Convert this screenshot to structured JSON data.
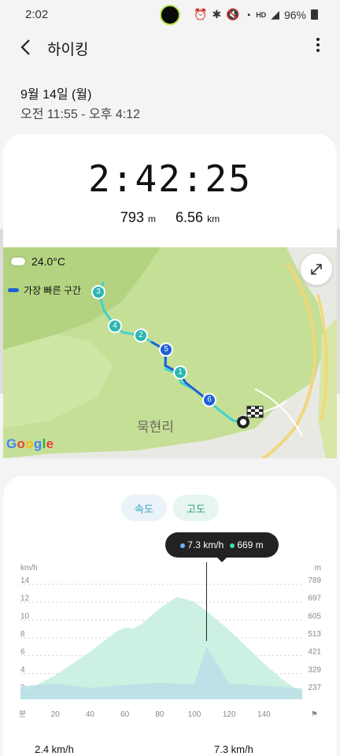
{
  "status": {
    "time": "2:02",
    "battery": "96%",
    "icons": [
      "alarm-icon",
      "bluetooth-icon",
      "mute-icon",
      "wifi-icon",
      "hd-icon",
      "signal-icon",
      "battery-icon"
    ]
  },
  "appbar": {
    "title": "하이킹"
  },
  "session": {
    "date": "9월 14일 (월)",
    "time_range": "오전 11:55 - 오후 4:12"
  },
  "summary": {
    "duration": "2:42:25",
    "elevation_value": "793",
    "elevation_unit": "m",
    "distance_value": "6.56",
    "distance_unit": "km"
  },
  "map": {
    "temperature": "24.0°C",
    "legend_label": "가장 빠른 구간",
    "place_label": "묵현리",
    "google_label": "Google",
    "waypoints": [
      "3",
      "4",
      "2",
      "5",
      "1",
      "6"
    ]
  },
  "chart_tabs": [
    "속도",
    "고도"
  ],
  "tooltip": {
    "speed": "7.3 km/h",
    "altitude": "669 m"
  },
  "chart_data": {
    "type": "area",
    "x_unit_label": "분",
    "x_ticks": [
      "20",
      "40",
      "60",
      "80",
      "100",
      "120",
      "140"
    ],
    "xlim": [
      0,
      162
    ],
    "left_axis_label": "km/h",
    "left_ticks": [
      "14",
      "12",
      "10",
      "8",
      "6",
      "4",
      "2"
    ],
    "right_axis_label": "m",
    "right_ticks": [
      "789",
      "697",
      "605",
      "513",
      "421",
      "329",
      "237"
    ],
    "series": [
      {
        "name": "고도",
        "unit": "m",
        "x": [
          0,
          20,
          40,
          55,
          60,
          65,
          70,
          80,
          90,
          100,
          110,
          120,
          130,
          140,
          150,
          162
        ],
        "values": [
          180,
          290,
          430,
          550,
          575,
          570,
          600,
          690,
          760,
          730,
          650,
          560,
          460,
          360,
          270,
          180
        ]
      },
      {
        "name": "속도",
        "unit": "km/h",
        "x": [
          0,
          20,
          40,
          60,
          80,
          100,
          107,
          120,
          140,
          162
        ],
        "values": [
          1.8,
          2.2,
          1.6,
          2.0,
          2.3,
          2.1,
          7.3,
          2.2,
          1.9,
          1.5
        ]
      }
    ],
    "cursor_x": 107,
    "colors": {
      "altitude_fill": "#c6f0df",
      "speed_fill": "#b9dfe7",
      "accent": "#1f5fd6"
    }
  },
  "bottom_stats": {
    "avg_speed": "2.4 km/h",
    "max_speed": "7.3 km/h"
  }
}
